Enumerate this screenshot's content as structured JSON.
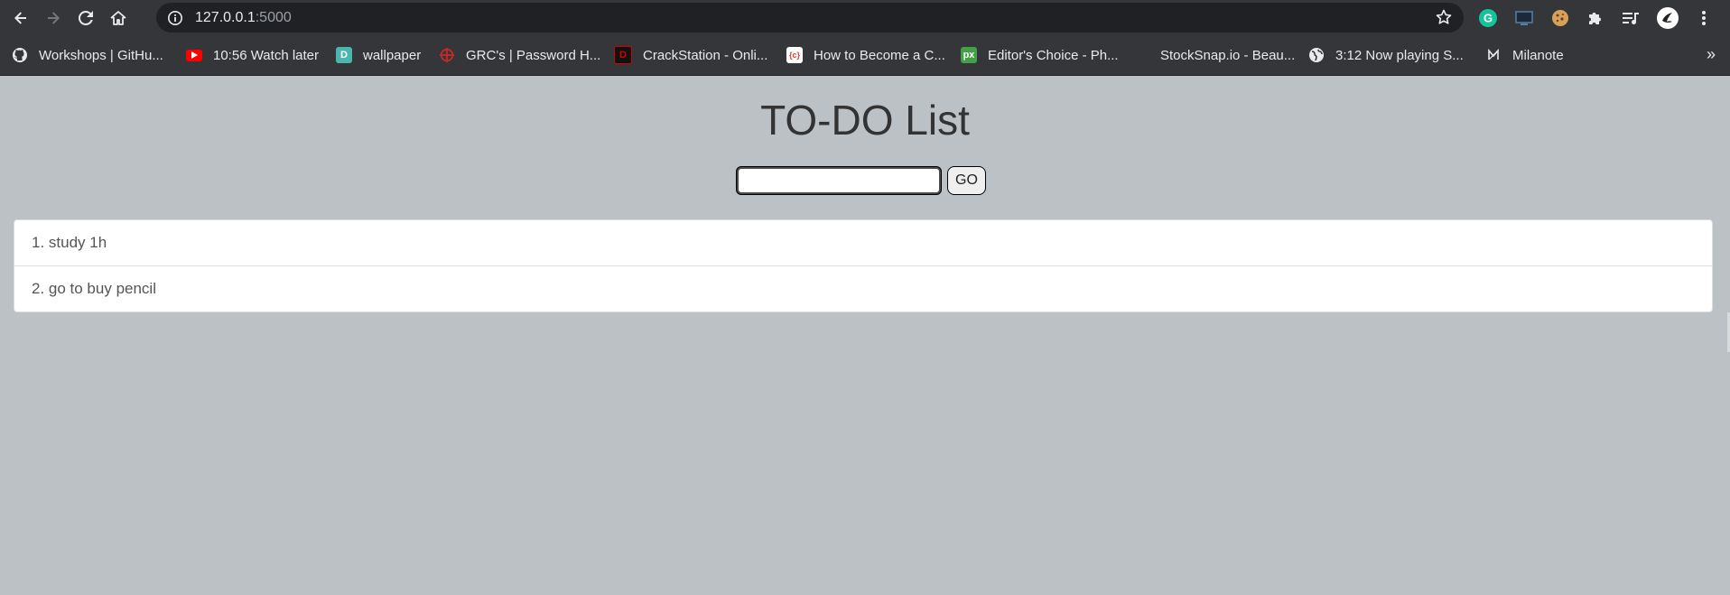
{
  "browser": {
    "url_host": "127.0.0.1",
    "url_port": ":5000",
    "toolbar": {
      "back": "back-arrow-icon",
      "forward": "forward-arrow-icon",
      "reload": "reload-icon",
      "home": "home-icon"
    },
    "extensions": [
      "grammarly-icon",
      "screen-cast-icon",
      "cookie-icon",
      "puzzle-extensions-icon",
      "media-queue-icon",
      "profile-avatar",
      "kebab-menu-icon"
    ]
  },
  "bookmarks": [
    {
      "label": "Workshops | GitHu...",
      "icon": "github-icon",
      "color": "#e8eaed"
    },
    {
      "label": "10:56 Watch later",
      "icon": "youtube-icon",
      "color": "#ff0000"
    },
    {
      "label": "wallpaper",
      "icon": "wallpaper-icon",
      "color": "#4db6ac"
    },
    {
      "label": "GRC's | Password H...",
      "icon": "grc-icon",
      "color": "#c62828"
    },
    {
      "label": "CrackStation - Onli...",
      "icon": "crackstation-icon",
      "color": "#d50000"
    },
    {
      "label": "How to Become a C...",
      "icon": "code-icon",
      "color": "#e53935"
    },
    {
      "label": "Editor's Choice - Ph...",
      "icon": "px-icon",
      "color": "#43a047"
    },
    {
      "label": "StockSnap.io - Beau...",
      "icon": "",
      "color": ""
    },
    {
      "label": "3:12 Now playing S...",
      "icon": "globe-icon",
      "color": "#e8eaed"
    },
    {
      "label": "Milanote",
      "icon": "milanote-icon",
      "color": "#e8eaed"
    }
  ],
  "bookmarks_overflow": "»",
  "page": {
    "title": "TO-DO List",
    "input_value": "",
    "go_label": "GO",
    "items": [
      "1. study 1h",
      "2. go to buy pencil"
    ]
  }
}
